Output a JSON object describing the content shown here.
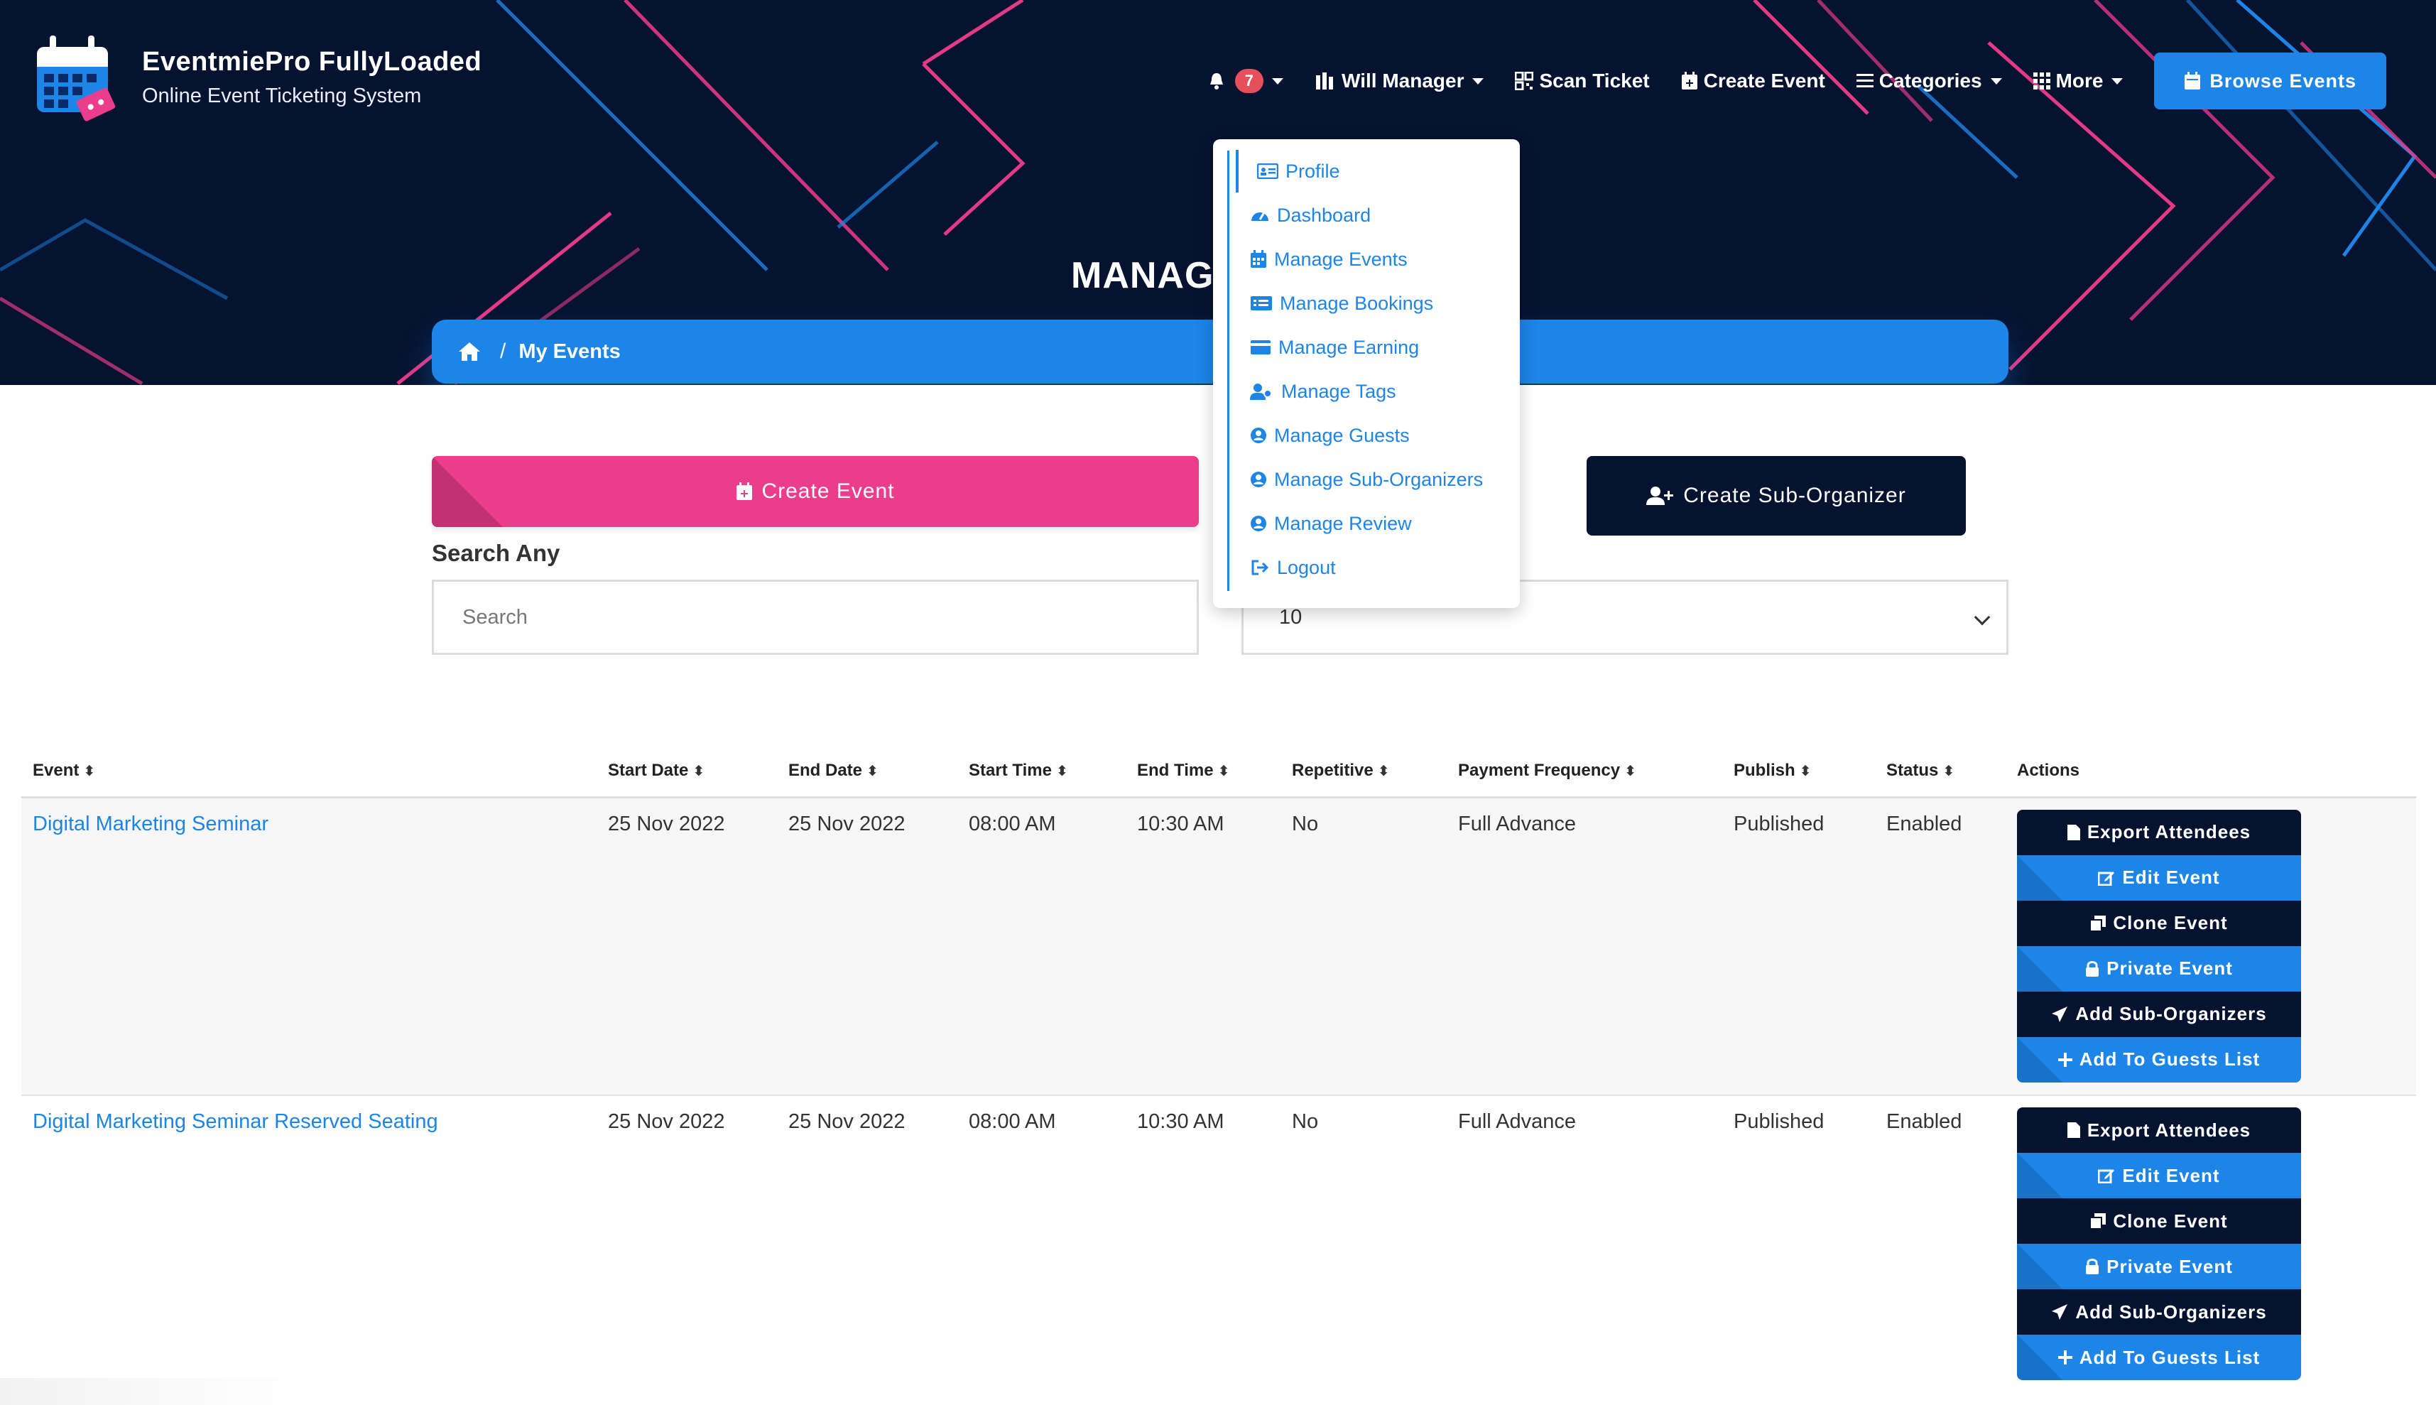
{
  "brand": {
    "title": "EventmiePro FullyLoaded",
    "subtitle": "Online Event Ticketing System"
  },
  "nav": {
    "notification_count": "7",
    "user_label": "Will Manager",
    "scan_ticket": "Scan Ticket",
    "create_event": "Create Event",
    "categories": "Categories",
    "more": "More",
    "browse_events": "Browse Events"
  },
  "page": {
    "heading": "MANAGE"
  },
  "breadcrumb": {
    "current": "My Events"
  },
  "controls": {
    "create_event": "Create Event",
    "create_sub_organizer": "Create Sub-Organizer",
    "search_label": "Search Any",
    "search_placeholder": "Search",
    "search_value": "",
    "per_page": "10"
  },
  "user_menu": {
    "items": [
      {
        "label": "Profile",
        "icon": "id-card-icon"
      },
      {
        "label": "Dashboard",
        "icon": "gauge-icon"
      },
      {
        "label": "Manage Events",
        "icon": "calendar-icon"
      },
      {
        "label": "Manage Bookings",
        "icon": "ticket-card-icon"
      },
      {
        "label": "Manage Earning",
        "icon": "wallet-icon"
      },
      {
        "label": "Manage Tags",
        "icon": "users-icon"
      },
      {
        "label": "Manage Guests",
        "icon": "user-circle-icon"
      },
      {
        "label": "Manage Sub-Organizers",
        "icon": "user-circle-icon"
      },
      {
        "label": "Manage Review",
        "icon": "user-circle-icon"
      },
      {
        "label": "Logout",
        "icon": "logout-icon"
      }
    ]
  },
  "table": {
    "columns": [
      "Event",
      "Start Date",
      "End Date",
      "Start Time",
      "End Time",
      "Repetitive",
      "Payment Frequency",
      "Publish",
      "Status",
      "Actions"
    ],
    "rows": [
      {
        "event": "Digital Marketing Seminar",
        "start_date": "25 Nov 2022",
        "end_date": "25 Nov 2022",
        "start_time": "08:00 AM",
        "end_time": "10:30 AM",
        "repetitive": "No",
        "payment_frequency": "Full Advance",
        "publish": "Published",
        "status": "Enabled"
      },
      {
        "event": "Digital Marketing Seminar Reserved Seating",
        "start_date": "25 Nov 2022",
        "end_date": "25 Nov 2022",
        "start_time": "08:00 AM",
        "end_time": "10:30 AM",
        "repetitive": "No",
        "payment_frequency": "Full Advance",
        "publish": "Published",
        "status": "Enabled"
      }
    ],
    "actions": {
      "export_attendees": "Export Attendees",
      "edit_event": "Edit Event",
      "clone_event": "Clone Event",
      "private_event": "Private Event",
      "add_sub_organizers": "Add Sub-Organizers",
      "add_to_guests_list": "Add To Guests List"
    }
  },
  "colors": {
    "navy": "#061330",
    "blue": "#1d84e8",
    "pink": "#ec3d8c",
    "badge_red": "#e7505a"
  }
}
